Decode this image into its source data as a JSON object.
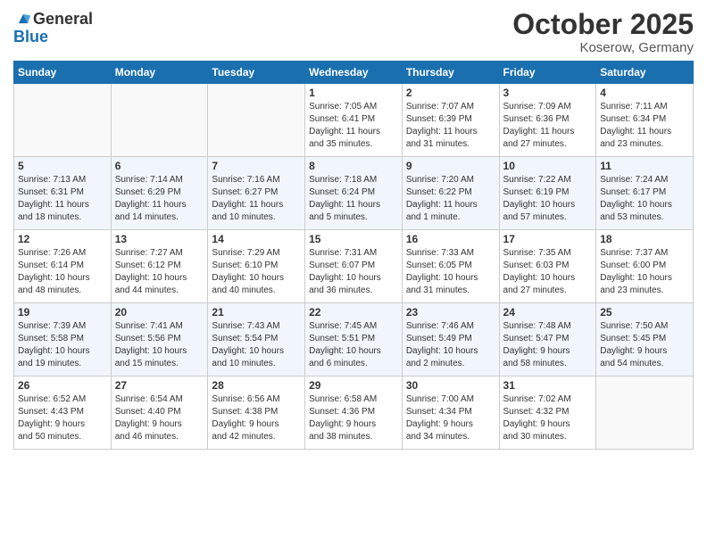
{
  "header": {
    "logo_general": "General",
    "logo_blue": "Blue",
    "month": "October 2025",
    "location": "Koserow, Germany"
  },
  "weekdays": [
    "Sunday",
    "Monday",
    "Tuesday",
    "Wednesday",
    "Thursday",
    "Friday",
    "Saturday"
  ],
  "weeks": [
    [
      {
        "day": "",
        "info": ""
      },
      {
        "day": "",
        "info": ""
      },
      {
        "day": "",
        "info": ""
      },
      {
        "day": "1",
        "info": "Sunrise: 7:05 AM\nSunset: 6:41 PM\nDaylight: 11 hours\nand 35 minutes."
      },
      {
        "day": "2",
        "info": "Sunrise: 7:07 AM\nSunset: 6:39 PM\nDaylight: 11 hours\nand 31 minutes."
      },
      {
        "day": "3",
        "info": "Sunrise: 7:09 AM\nSunset: 6:36 PM\nDaylight: 11 hours\nand 27 minutes."
      },
      {
        "day": "4",
        "info": "Sunrise: 7:11 AM\nSunset: 6:34 PM\nDaylight: 11 hours\nand 23 minutes."
      }
    ],
    [
      {
        "day": "5",
        "info": "Sunrise: 7:13 AM\nSunset: 6:31 PM\nDaylight: 11 hours\nand 18 minutes."
      },
      {
        "day": "6",
        "info": "Sunrise: 7:14 AM\nSunset: 6:29 PM\nDaylight: 11 hours\nand 14 minutes."
      },
      {
        "day": "7",
        "info": "Sunrise: 7:16 AM\nSunset: 6:27 PM\nDaylight: 11 hours\nand 10 minutes."
      },
      {
        "day": "8",
        "info": "Sunrise: 7:18 AM\nSunset: 6:24 PM\nDaylight: 11 hours\nand 5 minutes."
      },
      {
        "day": "9",
        "info": "Sunrise: 7:20 AM\nSunset: 6:22 PM\nDaylight: 11 hours\nand 1 minute."
      },
      {
        "day": "10",
        "info": "Sunrise: 7:22 AM\nSunset: 6:19 PM\nDaylight: 10 hours\nand 57 minutes."
      },
      {
        "day": "11",
        "info": "Sunrise: 7:24 AM\nSunset: 6:17 PM\nDaylight: 10 hours\nand 53 minutes."
      }
    ],
    [
      {
        "day": "12",
        "info": "Sunrise: 7:26 AM\nSunset: 6:14 PM\nDaylight: 10 hours\nand 48 minutes."
      },
      {
        "day": "13",
        "info": "Sunrise: 7:27 AM\nSunset: 6:12 PM\nDaylight: 10 hours\nand 44 minutes."
      },
      {
        "day": "14",
        "info": "Sunrise: 7:29 AM\nSunset: 6:10 PM\nDaylight: 10 hours\nand 40 minutes."
      },
      {
        "day": "15",
        "info": "Sunrise: 7:31 AM\nSunset: 6:07 PM\nDaylight: 10 hours\nand 36 minutes."
      },
      {
        "day": "16",
        "info": "Sunrise: 7:33 AM\nSunset: 6:05 PM\nDaylight: 10 hours\nand 31 minutes."
      },
      {
        "day": "17",
        "info": "Sunrise: 7:35 AM\nSunset: 6:03 PM\nDaylight: 10 hours\nand 27 minutes."
      },
      {
        "day": "18",
        "info": "Sunrise: 7:37 AM\nSunset: 6:00 PM\nDaylight: 10 hours\nand 23 minutes."
      }
    ],
    [
      {
        "day": "19",
        "info": "Sunrise: 7:39 AM\nSunset: 5:58 PM\nDaylight: 10 hours\nand 19 minutes."
      },
      {
        "day": "20",
        "info": "Sunrise: 7:41 AM\nSunset: 5:56 PM\nDaylight: 10 hours\nand 15 minutes."
      },
      {
        "day": "21",
        "info": "Sunrise: 7:43 AM\nSunset: 5:54 PM\nDaylight: 10 hours\nand 10 minutes."
      },
      {
        "day": "22",
        "info": "Sunrise: 7:45 AM\nSunset: 5:51 PM\nDaylight: 10 hours\nand 6 minutes."
      },
      {
        "day": "23",
        "info": "Sunrise: 7:46 AM\nSunset: 5:49 PM\nDaylight: 10 hours\nand 2 minutes."
      },
      {
        "day": "24",
        "info": "Sunrise: 7:48 AM\nSunset: 5:47 PM\nDaylight: 9 hours\nand 58 minutes."
      },
      {
        "day": "25",
        "info": "Sunrise: 7:50 AM\nSunset: 5:45 PM\nDaylight: 9 hours\nand 54 minutes."
      }
    ],
    [
      {
        "day": "26",
        "info": "Sunrise: 6:52 AM\nSunset: 4:43 PM\nDaylight: 9 hours\nand 50 minutes."
      },
      {
        "day": "27",
        "info": "Sunrise: 6:54 AM\nSunset: 4:40 PM\nDaylight: 9 hours\nand 46 minutes."
      },
      {
        "day": "28",
        "info": "Sunrise: 6:56 AM\nSunset: 4:38 PM\nDaylight: 9 hours\nand 42 minutes."
      },
      {
        "day": "29",
        "info": "Sunrise: 6:58 AM\nSunset: 4:36 PM\nDaylight: 9 hours\nand 38 minutes."
      },
      {
        "day": "30",
        "info": "Sunrise: 7:00 AM\nSunset: 4:34 PM\nDaylight: 9 hours\nand 34 minutes."
      },
      {
        "day": "31",
        "info": "Sunrise: 7:02 AM\nSunset: 4:32 PM\nDaylight: 9 hours\nand 30 minutes."
      },
      {
        "day": "",
        "info": ""
      }
    ]
  ]
}
